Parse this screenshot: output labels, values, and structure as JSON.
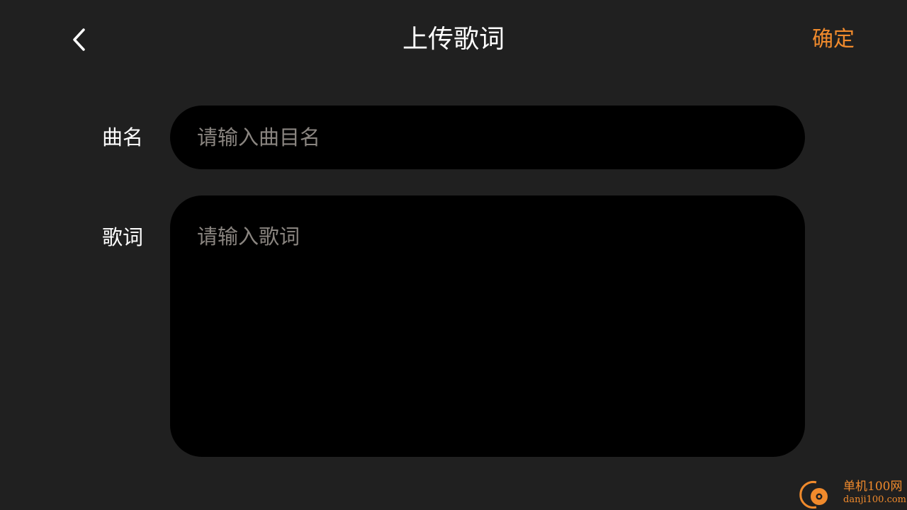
{
  "header": {
    "back_icon": "chevron-left-icon",
    "title": "上传歌词",
    "confirm_label": "确定"
  },
  "form": {
    "song_name": {
      "label": "曲名",
      "value": "",
      "placeholder": "请输入曲目名"
    },
    "lyrics": {
      "label": "歌词",
      "value": "",
      "placeholder": "请输入歌词"
    }
  },
  "watermark": {
    "name": "单机100网",
    "url": "danji100.com"
  },
  "colors": {
    "background": "#202020",
    "field_background": "#000000",
    "accent": "#f08a2c",
    "placeholder": "#8a8580",
    "text": "#ffffff"
  }
}
